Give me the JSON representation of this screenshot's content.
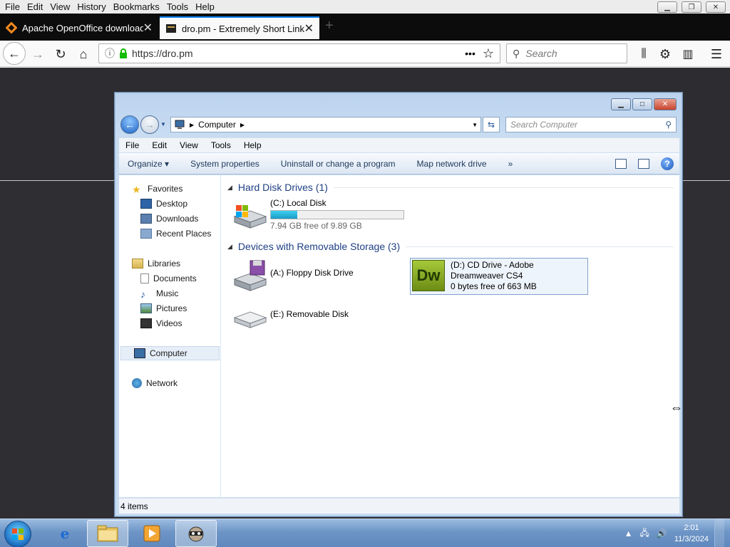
{
  "firefox": {
    "menu": [
      "File",
      "Edit",
      "View",
      "History",
      "Bookmarks",
      "Tools",
      "Help"
    ],
    "tabs": [
      {
        "title": "Apache OpenOffice download",
        "active": false
      },
      {
        "title": "dro.pm - Extremely Short Links",
        "active": true
      }
    ],
    "url": "https://dro.pm",
    "search_placeholder": "Search",
    "overflow": "•••"
  },
  "explorer": {
    "breadcrumb": "Computer",
    "search_placeholder": "Search Computer",
    "menu": [
      "File",
      "Edit",
      "View",
      "Tools",
      "Help"
    ],
    "commands": [
      "Organize ▾",
      "System properties",
      "Uninstall or change a program",
      "Map network drive",
      "»"
    ],
    "nav": {
      "favorites": "Favorites",
      "desktop": "Desktop",
      "downloads": "Downloads",
      "recent": "Recent Places",
      "libraries": "Libraries",
      "documents": "Documents",
      "music": "Music",
      "pictures": "Pictures",
      "videos": "Videos",
      "computer": "Computer",
      "network": "Network"
    },
    "groups": {
      "hdd": "Hard Disk Drives (1)",
      "removable": "Devices with Removable Storage (3)"
    },
    "drives": {
      "c": {
        "name": "(C:) Local Disk",
        "free": "7.94 GB free of 9.89 GB",
        "used_fraction": 0.197
      },
      "a": {
        "name": "(A:) Floppy Disk Drive"
      },
      "d": {
        "name": "(D:) CD Drive - Adobe Dreamweaver CS4",
        "free": "0 bytes free of 663 MB",
        "logo": "Dw"
      },
      "e": {
        "name": "(E:) Removable Disk"
      }
    },
    "status": "4 items"
  },
  "taskbar": {
    "time": "2:01",
    "date": "11/3/2024"
  }
}
